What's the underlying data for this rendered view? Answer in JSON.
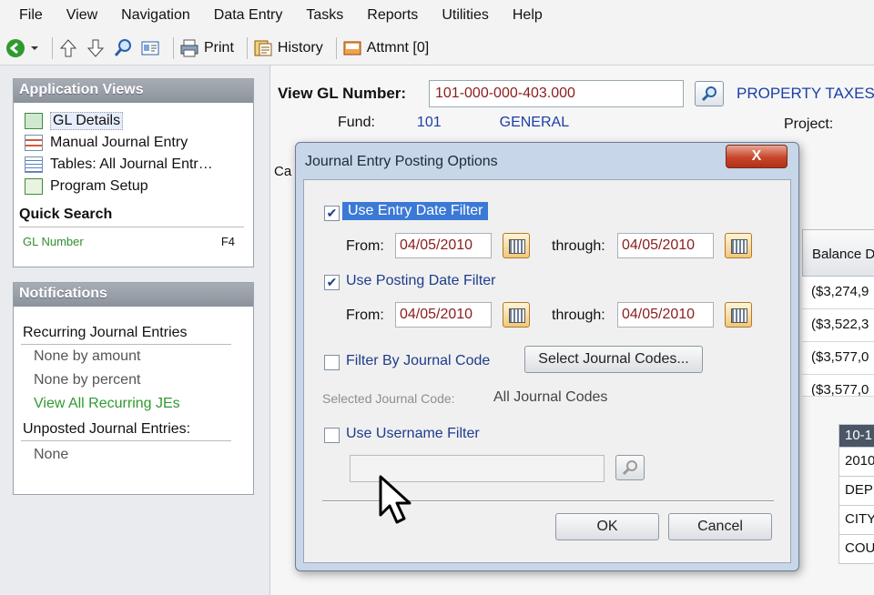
{
  "menu": [
    "File",
    "View",
    "Navigation",
    "Data Entry",
    "Tasks",
    "Reports",
    "Utilities",
    "Help"
  ],
  "toolbar": {
    "print": "Print",
    "history": "History",
    "attachment": "Attmnt [0]"
  },
  "app_views": {
    "title": "Application Views",
    "items": [
      "GL Details",
      "Manual Journal Entry",
      "Tables: All Journal Entr…",
      "Program Setup"
    ],
    "quick_search_title": "Quick Search",
    "quick_search_field": "GL Number",
    "quick_search_key": "F4"
  },
  "notifications": {
    "title": "Notifications",
    "recurring_title": "Recurring Journal Entries",
    "none_amount": "None by amount",
    "none_percent": "None by percent",
    "view_all": "View All Recurring JEs",
    "unposted_title": "Unposted Journal Entries:",
    "unposted_none": "None"
  },
  "main": {
    "gl_label": "View GL Number:",
    "gl_value": "101-000-000-403.000",
    "gl_desc": "PROPERTY TAXES",
    "fund_label": "Fund:",
    "fund_num": "101",
    "fund_name": "GENERAL",
    "project_label": "Project:",
    "ca_label": "Ca",
    "grid_header": "Balance D",
    "grid_values": [
      "($3,274,9",
      "($3,522,3",
      "($3,577,0",
      "($3,577,0"
    ],
    "right_header": "10-1",
    "right_values": [
      "2010",
      "DEP",
      "CITY",
      "COU"
    ]
  },
  "dialog": {
    "title": "Journal Entry Posting Options",
    "close": "X",
    "entry_date_filter": "Use Entry Date Filter",
    "from_label": "From:",
    "through_label": "through:",
    "entry_from": "04/05/2010",
    "entry_through": "04/05/2010",
    "posting_date_filter": "Use Posting Date Filter",
    "posting_from": "04/05/2010",
    "posting_through": "04/05/2010",
    "journal_code_filter": "Filter By Journal Code",
    "select_codes": "Select Journal Codes...",
    "selected_code_label": "Selected Journal Code:",
    "selected_code_value": "All Journal Codes",
    "username_filter": "Use Username Filter",
    "ok": "OK",
    "cancel": "Cancel",
    "entry_checked": true,
    "posting_checked": true
  }
}
